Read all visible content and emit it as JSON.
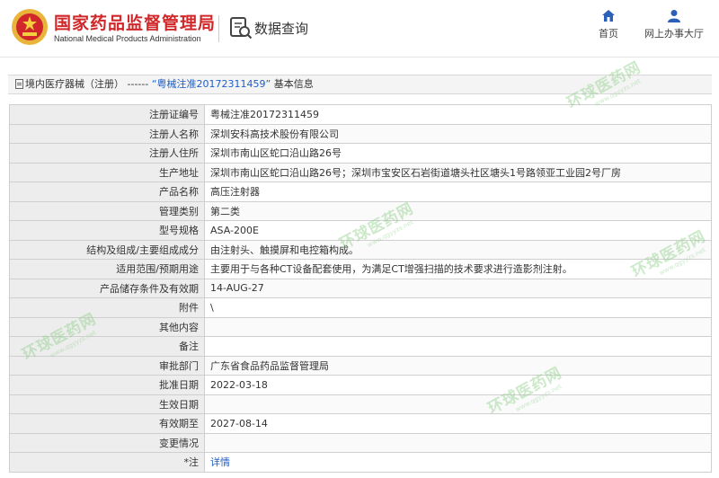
{
  "header": {
    "brand_cn": "国家药品监督管理局",
    "brand_en": "National Medical Products Administration",
    "query_label": "数据查询",
    "nav": [
      {
        "label": "首页",
        "icon": "home-icon"
      },
      {
        "label": "网上办事大厅",
        "icon": "user-hall-icon"
      }
    ]
  },
  "breadcrumb": {
    "prefix": "境内医疗器械（注册）",
    "separator": "------",
    "record": "“粤械注准20172311459”",
    "suffix": "基本信息"
  },
  "table": {
    "rows": [
      {
        "label": "注册证编号",
        "value": "粤械注准20172311459"
      },
      {
        "label": "注册人名称",
        "value": "深圳安科高技术股份有限公司"
      },
      {
        "label": "注册人住所",
        "value": "深圳市南山区蛇口沿山路26号"
      },
      {
        "label": "生产地址",
        "value": "深圳市南山区蛇口沿山路26号；深圳市宝安区石岩街道塘头社区塘头1号路领亚工业园2号厂房"
      },
      {
        "label": "产品名称",
        "value": "高压注射器"
      },
      {
        "label": "管理类别",
        "value": "第二类"
      },
      {
        "label": "型号规格",
        "value": "ASA-200E"
      },
      {
        "label": "结构及组成/主要组成成分",
        "value": "由注射头、触摸屏和电控箱构成。"
      },
      {
        "label": "适用范围/预期用途",
        "value": "主要用于与各种CT设备配套使用，为满足CT增强扫描的技术要求进行造影剂注射。"
      },
      {
        "label": "产品储存条件及有效期",
        "value": "14-AUG-27"
      },
      {
        "label": "附件",
        "value": "\\"
      },
      {
        "label": "其他内容",
        "value": ""
      },
      {
        "label": "备注",
        "value": ""
      },
      {
        "label": "审批部门",
        "value": "广东省食品药品监督管理局"
      },
      {
        "label": "批准日期",
        "value": "2022-03-18"
      },
      {
        "label": "生效日期",
        "value": ""
      },
      {
        "label": "有效期至",
        "value": "2027-08-14"
      },
      {
        "label": "变更情况",
        "value": ""
      }
    ],
    "note_label": "注",
    "note_link": "详情"
  },
  "watermark": {
    "text": "环球医药网",
    "url": "www.qgyyzs.net"
  },
  "colors": {
    "brand_red": "#d0282a",
    "link_blue": "#1e5ec8",
    "label_bg": "#ededed",
    "watermark_green": "#8fcf8a"
  }
}
